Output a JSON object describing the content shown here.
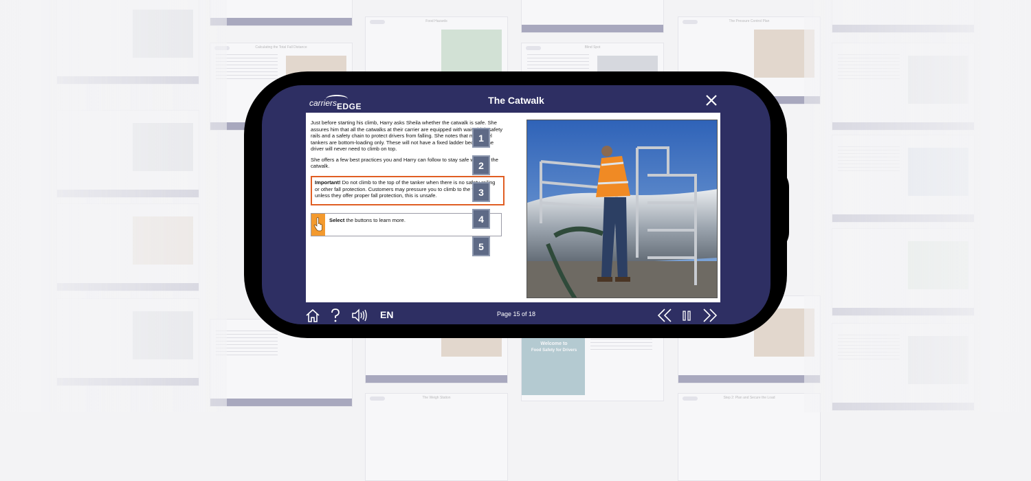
{
  "app": {
    "logo_text_a": "carriers",
    "logo_text_b": "EDGE",
    "title": "The Catwalk"
  },
  "content": {
    "paragraph_1": "Just before starting his climb, Harry asks Sheila whether the catwalk is safe. She assures him that all the catwalks at their carrier are equipped with waist-high safety rails and a safety chain to protect drivers from falling. She notes that many fuel tankers are bottom-loading only. These will not have a fixed ladder because the driver will never need to climb on top.",
    "paragraph_2": "She offers a few best practices you and Harry can follow to stay safe while on the catwalk.",
    "important_label": "Important!",
    "important_text": " Do not climb to the top of the tanker when there is no safety railing or other fall protection. Customers may pressure you to climb to the top, but unless they offer proper fall protection, this is unsafe.",
    "instruction_bold": "Select",
    "instruction_rest": " the buttons to learn more.",
    "buttons": [
      "1",
      "2",
      "3",
      "4",
      "5"
    ]
  },
  "footer": {
    "language": "EN",
    "page_indicator": "Page 15 of 18"
  },
  "background_thumbnails": {
    "titles": [
      "Calculating the Total Fall Distance",
      "Food Hazards",
      "Blind Spot",
      "The Pressure Control Plan",
      "The Weigh Station"
    ],
    "welcome_title": "Welcome to",
    "welcome_subtitle": "Food Safety for Drivers",
    "step_title": "Step 2: Plan and Secure the Load"
  },
  "colors": {
    "frame": "#2e2f63",
    "accent_orange": "#e05d22",
    "button_bg": "#5e6a86",
    "hand_icon": "#f39a2e"
  }
}
